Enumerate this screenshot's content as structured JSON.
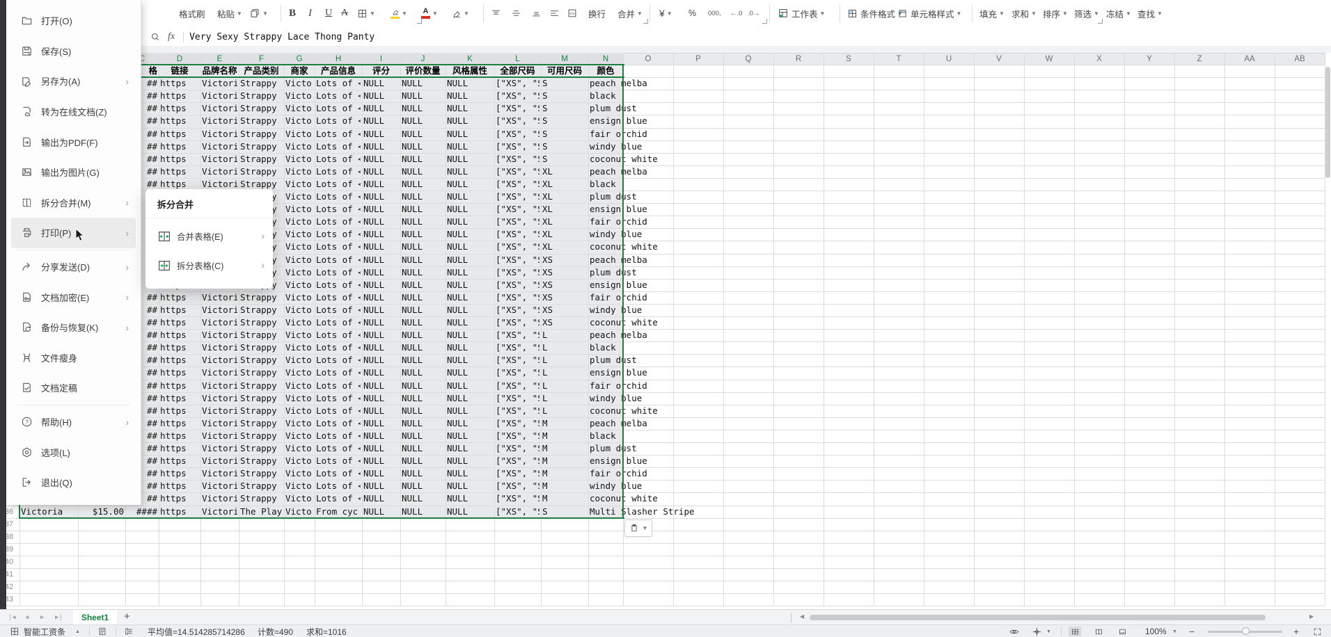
{
  "file_menu": {
    "items": [
      {
        "id": "open",
        "label": "打开(O)",
        "icon": "folder-open-icon",
        "chevron": false,
        "hover": false,
        "sep_before": false
      },
      {
        "id": "save",
        "label": "保存(S)",
        "icon": "save-icon",
        "chevron": false,
        "hover": false,
        "sep_before": false
      },
      {
        "id": "save-as",
        "label": "另存为(A)",
        "icon": "save-as-icon",
        "chevron": true,
        "hover": false,
        "sep_before": false
      },
      {
        "id": "online-doc",
        "label": "转为在线文档(Z)",
        "icon": "online-doc-icon",
        "chevron": false,
        "hover": false,
        "sep_before": false
      },
      {
        "id": "export-pdf",
        "label": "输出为PDF(F)",
        "icon": "export-pdf-icon",
        "chevron": false,
        "hover": false,
        "sep_before": false
      },
      {
        "id": "export-image",
        "label": "输出为图片(G)",
        "icon": "export-image-icon",
        "chevron": false,
        "hover": false,
        "sep_before": false
      },
      {
        "id": "split-merge",
        "label": "拆分合并(M)",
        "icon": "split-merge-icon",
        "chevron": true,
        "hover": false,
        "sep_before": false
      },
      {
        "id": "print",
        "label": "打印(P)",
        "icon": "print-icon",
        "chevron": true,
        "hover": true,
        "sep_before": false
      },
      {
        "id": "share-send",
        "label": "分享发送(D)",
        "icon": "share-icon",
        "chevron": true,
        "hover": false,
        "sep_before": true
      },
      {
        "id": "encrypt",
        "label": "文档加密(E)",
        "icon": "encrypt-icon",
        "chevron": true,
        "hover": false,
        "sep_before": false
      },
      {
        "id": "backup-restore",
        "label": "备份与恢复(K)",
        "icon": "backup-icon",
        "chevron": true,
        "hover": false,
        "sep_before": false
      },
      {
        "id": "file-slim",
        "label": "文件瘦身",
        "icon": "file-slim-icon",
        "chevron": false,
        "hover": false,
        "sep_before": false
      },
      {
        "id": "finalize",
        "label": "文档定稿",
        "icon": "finalize-icon",
        "chevron": false,
        "hover": false,
        "sep_before": false
      },
      {
        "id": "help",
        "label": "帮助(H)",
        "icon": "help-icon",
        "chevron": true,
        "hover": false,
        "sep_before": true
      },
      {
        "id": "options",
        "label": "选项(L)",
        "icon": "options-icon",
        "chevron": false,
        "hover": false,
        "sep_before": false
      },
      {
        "id": "exit",
        "label": "退出(Q)",
        "icon": "exit-icon",
        "chevron": false,
        "hover": false,
        "sep_before": false
      }
    ]
  },
  "submenu": {
    "title": "拆分合并",
    "items": [
      {
        "id": "merge-tables",
        "label": "合并表格(E)",
        "icon": "merge-table-icon"
      },
      {
        "id": "split-tables",
        "label": "拆分表格(C)",
        "icon": "split-table-icon"
      }
    ]
  },
  "toolbar": {
    "format_painter": "格式刷",
    "paste": "粘贴",
    "bold": "B",
    "italic": "I",
    "underline": "U",
    "strike": "A",
    "wrap": "换行",
    "merge": "合并",
    "currency": "¥",
    "percent": "%",
    "thousands": "000,",
    "dec_inc": "←.0",
    "dec_dec": ".0→",
    "worksheet": "工作表",
    "cond_format": "条件格式",
    "cell_style": "单元格样式",
    "fill": "填充",
    "sum": "求和",
    "sort": "排序",
    "filter": "筛选",
    "freeze": "冻结",
    "find": "查找"
  },
  "formula_bar": {
    "fx_label": "fx",
    "value": "Very Sexy Strappy Lace Thong Panty"
  },
  "sheet": {
    "selected_column_letters": [
      "D",
      "E",
      "F",
      "G",
      "H",
      "I",
      "J",
      "K",
      "L",
      "M",
      "N"
    ],
    "other_column_letters": [
      "O",
      "P",
      "Q",
      "R",
      "S",
      "T",
      "U",
      "V",
      "W",
      "X",
      "Y",
      "Z",
      "AA",
      "AB"
    ],
    "header_row": {
      "C": "格",
      "D": "链接",
      "E": "品牌名称",
      "F": "产品类别",
      "G": "商家",
      "H": "产品信息",
      "I": "评分",
      "J": "评价数量",
      "K": "风格属性",
      "L": "全部尺码",
      "M": "可用尺码",
      "N": "颜色"
    },
    "row_template": {
      "C": "##",
      "D": "https",
      "E": "Victoria'",
      "F": "Strappy I",
      "G": "Victo",
      "H": "Lots of <",
      "I": "NULL",
      "J": "NULL",
      "K": "NULL",
      "L": "[\"XS\", \"S"
    },
    "product_rows": [
      {
        "size": "S",
        "color": "peach melba"
      },
      {
        "size": "S",
        "color": "black"
      },
      {
        "size": "S",
        "color": "plum dust"
      },
      {
        "size": "S",
        "color": "ensign blue"
      },
      {
        "size": "S",
        "color": "fair orchid"
      },
      {
        "size": "S",
        "color": "windy blue"
      },
      {
        "size": "S",
        "color": "coconut white"
      },
      {
        "size": "XL",
        "color": "peach melba"
      },
      {
        "size": "XL",
        "color": "black"
      },
      {
        "size": "XL",
        "color": "plum dust"
      },
      {
        "size": "XL",
        "color": "ensign blue"
      },
      {
        "size": "XL",
        "color": "fair orchid"
      },
      {
        "size": "XL",
        "color": "windy blue"
      },
      {
        "size": "XL",
        "color": "coconut white"
      },
      {
        "size": "XS",
        "color": "peach melba"
      },
      {
        "size": "XS",
        "color": "plum dust"
      },
      {
        "size": "XS",
        "color": "ensign blue"
      },
      {
        "size": "XS",
        "color": "fair orchid"
      },
      {
        "size": "XS",
        "color": "windy blue"
      },
      {
        "size": "XS",
        "color": "coconut white"
      },
      {
        "size": "L",
        "color": "peach melba"
      },
      {
        "size": "L",
        "color": "black"
      },
      {
        "size": "L",
        "color": "plum dust"
      },
      {
        "size": "L",
        "color": "ensign blue"
      },
      {
        "size": "L",
        "color": "fair orchid"
      },
      {
        "size": "L",
        "color": "windy blue"
      },
      {
        "size": "L",
        "color": "coconut white"
      },
      {
        "size": "M",
        "color": "peach melba"
      },
      {
        "size": "M",
        "color": "black"
      },
      {
        "size": "M",
        "color": "plum dust"
      },
      {
        "size": "M",
        "color": "ensign blue"
      },
      {
        "size": "M",
        "color": "fair orchid"
      },
      {
        "size": "M",
        "color": "windy blue"
      },
      {
        "size": "M",
        "color": "coconut white"
      }
    ],
    "row36": {
      "A": "Victoria",
      "B": "$15.00",
      "C": "####",
      "D": "https",
      "E": "Victoria'",
      "F": "The Playe",
      "G": "Victo",
      "H": "From cyc",
      "I": "NULL",
      "J": "NULL",
      "K": "NULL",
      "L": "[\"XS\", \"S",
      "M": "S",
      "N": "Multi Slasher Stripe"
    },
    "visible_row_numbers": [
      "36",
      "37",
      "38",
      "39",
      "40",
      "41",
      "42",
      "43"
    ]
  },
  "tab_bar": {
    "sheet_name": "Sheet1",
    "add_label": "+",
    "nav": [
      "|◀",
      "◀",
      "▶",
      "▶|"
    ]
  },
  "status_bar": {
    "plugin_label": "智能工资条",
    "average": "平均值=14.514285714286",
    "count": "计数=490",
    "sum": "求和=1016",
    "zoom_level": "100%"
  },
  "colors": {
    "selection_green": "#1b7f43",
    "header_letter_green": "#1c7d4b",
    "sheet_tab_green": "#15803d",
    "highlight_yellow": "#f3d321",
    "font_color_red": "#d93025",
    "selection_tint": "#e8e9ea"
  }
}
